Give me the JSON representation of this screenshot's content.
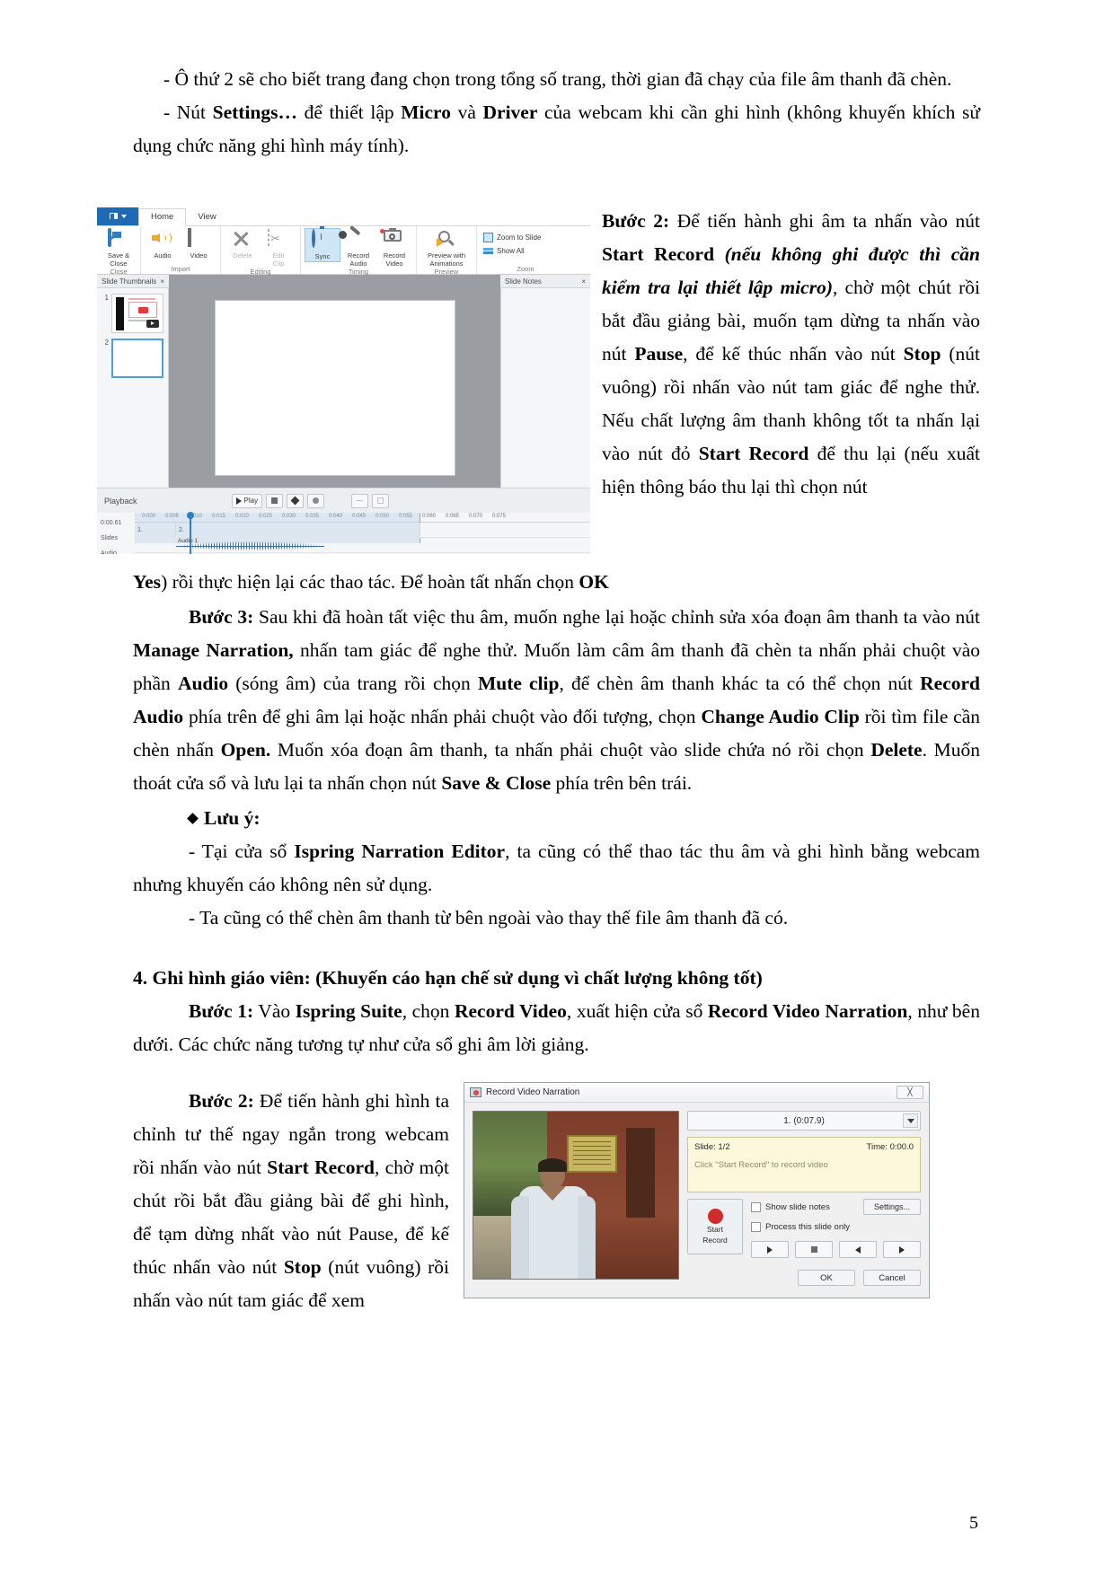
{
  "document": {
    "page_number": "5",
    "paragraphs": {
      "p1": "- Ô thứ 2 sẽ cho biết trang đang chọn trong tổng số trang, thời gian đã chạy của file âm thanh đã chèn.",
      "p2_a": "- Nút ",
      "p2_b": "Settings…",
      "p2_c": " để thiết lập ",
      "p2_d": "Micro",
      "p2_e": " và ",
      "p2_f": "Driver",
      "p2_g": " của webcam khi cần ghi hình (không khuyến khích sử dụng chức năng ghi hình máy tính).",
      "step2_label": "Bước 2:",
      "step2_t1": " Để tiến hành ghi âm ta nhấn vào nút ",
      "step2_b1": "Start Record",
      "step2_i1": " (nếu không ghi được thì cần kiểm tra lại thiết lập micro)",
      "step2_t2": ", chờ một chút rồi bắt đầu giảng bài, muốn tạm dừng ta nhấn vào nút ",
      "step2_b2": "Pause",
      "step2_t3": ", để kế thúc nhấn vào nút ",
      "step2_b3": "Stop",
      "step2_t4": " (nút vuông) rồi nhấn vào nút tam giác để nghe thử. Nếu chất lượng âm thanh không tốt ta nhấn lại vào nút đỏ ",
      "step2_b4": "Start Record",
      "step2_t5": " để thu lại (nếu xuất hiện thông báo thu lại thì chọn nút ",
      "step2_b5": "Yes",
      "step2_t6": ") rồi thực hiện lại các thao tác. Để hoàn tất nhấn chọn ",
      "step2_b6": "OK",
      "step3_label": "Bước 3:",
      "step3_t1": " Sau khi đã hoàn tất việc thu âm, muốn nghe lại hoặc chỉnh sửa xóa đoạn âm thanh ta vào nút ",
      "step3_b1": "Manage Narration,",
      "step3_t2": " nhấn tam giác để nghe thử. Muốn làm câm âm thanh đã chèn ta nhấn phải chuột vào phần ",
      "step3_b2": "Audio",
      "step3_t3": " (sóng âm) của trang rồi chọn ",
      "step3_b3": "Mute clip",
      "step3_t4": ", để chèn âm thanh khác ta có thể chọn nút ",
      "step3_b4": "Record  Audio",
      "step3_t5": " phía trên để ghi âm lại hoặc nhấn phải chuột vào đối tượng, chọn ",
      "step3_b5": "Change Audio Clip",
      "step3_t6": " rồi tìm file cần chèn nhấn ",
      "step3_b6": "Open.",
      "step3_t7": " Muốn xóa đoạn âm thanh, ta nhấn phải chuột vào slide chứa nó rồi chọn ",
      "step3_b7": "Delete",
      "step3_t8": ". Muốn thoát cửa sổ và lưu lại ta nhấn chọn nút ",
      "step3_b8": "Save & Close",
      "step3_t9": " phía trên bên trái.",
      "note_label": "Lưu ý:",
      "note1_a": "- Tại cửa sổ ",
      "note1_b": "Ispring Narration Editor",
      "note1_c": ", ta cũng có thể thao tác thu âm và ghi hình bằng webcam nhưng khuyến cáo không nên sử dụng.",
      "note2": "- Ta cũng có thể chèn âm thanh từ bên ngoài vào thay thế file âm thanh đã có.",
      "section4": "4. Ghi hình giáo viên: (Khuyến cáo hạn chế sử dụng vì chất lượng không tốt)",
      "s4step1_label": "Bước 1:",
      "s4step1_t1": " Vào ",
      "s4step1_b1": "Ispring Suite",
      "s4step1_t2": ", chọn  ",
      "s4step1_b2": "Record Video",
      "s4step1_t3": ", xuất hiện cửa sổ ",
      "s4step1_b3": "Record Video Narration",
      "s4step1_t4": ", như bên dưới. Các chức năng tương tự như cửa sổ ghi âm lời giảng.",
      "s4step2_label": "Bước 2:",
      "s4step2_t1": " Để tiến hành ghi hình ta chỉnh tư thế ngay ngắn trong webcam rồi nhấn vào nút ",
      "s4step2_b1": "Start Record",
      "s4step2_t2": ", chờ một chút rồi bắt đầu giảng bài để ghi hình, để tạm dừng nhất vào nút Pause, để kế thúc nhấn vào nút ",
      "s4step2_b2": "Stop",
      "s4step2_t3": " (nút vuông) rồi nhấn vào nút tam giác để xem"
    }
  },
  "narration_editor": {
    "file_menu": "file-menu",
    "tabs": [
      {
        "label": "Home",
        "active": true
      },
      {
        "label": "View",
        "active": false
      }
    ],
    "groups": [
      {
        "name": "Close",
        "items": [
          {
            "label": "Save &\nClose",
            "icon": "save-close-icon",
            "state": "normal"
          }
        ]
      },
      {
        "name": "Import",
        "items": [
          {
            "label": "Audio",
            "icon": "audio-icon",
            "state": "normal"
          },
          {
            "label": "Video",
            "icon": "video-icon",
            "state": "normal"
          }
        ]
      },
      {
        "name": "Editing",
        "items": [
          {
            "label": "Delete",
            "icon": "delete-icon",
            "state": "disabled"
          },
          {
            "label": "Edit\nClip",
            "icon": "edit-clip-icon",
            "state": "disabled"
          }
        ]
      },
      {
        "name": "Timing",
        "items": [
          {
            "label": "Sync",
            "icon": "sync-timer-icon",
            "state": "selected"
          },
          {
            "label": "Record\nAudio",
            "icon": "microphone-icon",
            "state": "normal"
          },
          {
            "label": "Record\nVideo",
            "icon": "webcam-icon",
            "state": "normal"
          }
        ]
      },
      {
        "name": "Preview",
        "items": [
          {
            "label": "Preview with\nAnimations",
            "icon": "preview-icon",
            "state": "normal"
          }
        ]
      },
      {
        "name": "Zoom",
        "items": [
          {
            "label": "Zoom to Slide",
            "icon": "zoom-to-slide-icon",
            "state": "small"
          },
          {
            "label": "Show All",
            "icon": "show-all-icon",
            "state": "small"
          }
        ]
      }
    ],
    "panels": {
      "thumbnails_title": "Slide Thumbnails",
      "thumbnails_close": "×",
      "notes_title": "Slide Notes",
      "notes_close": "×",
      "slides": [
        {
          "number": "1",
          "selected": false
        },
        {
          "number": "2",
          "selected": true
        }
      ]
    },
    "playback": {
      "label": "Playback",
      "play_button": "Play",
      "stop_button": "stop-icon",
      "prev_button": "prev-icon",
      "rec_button": "record-icon",
      "extra1": "zoom-out-icon",
      "extra2": "fit-icon"
    },
    "timeline": {
      "current_time": "0:00.61",
      "row_slides": "Slides",
      "row_audio": "Audio",
      "slide_cells": [
        "1.",
        "2."
      ],
      "audio_clip_label": "Audio 1",
      "ruler_ticks": [
        "0:000",
        "0:005",
        "0:010",
        "0:015",
        "0:020",
        "0:025",
        "0:030",
        "0:035",
        "0:040",
        "0:045",
        "0:050",
        "0:055",
        "0:060",
        "0:065",
        "0:070",
        "0:075"
      ]
    }
  },
  "record_video_dialog": {
    "title": "Record Video Narration",
    "title_icon": "record-video-icon",
    "close_button": "╳",
    "camera_preview": "webcam-preview",
    "slide_selector": "1. (0:07.9)",
    "status": {
      "slide_label": "Slide: 1/2",
      "time_label": "Time: 0:00.0",
      "hint": "Click \"Start Record\" to record video"
    },
    "start_record_button": "Start\nRecord",
    "start_record_line1": "Start",
    "start_record_line2": "Record",
    "checkbox_show_notes": "Show slide notes",
    "checkbox_process_slide": "Process this slide only",
    "settings_button": "Settings...",
    "transport": {
      "play": "play-icon",
      "stop": "stop-icon",
      "prev": "prev-icon",
      "next": "next-icon"
    },
    "ok_button": "OK",
    "cancel_button": "Cancel"
  },
  "colors": {
    "accent_blue": "#1e6ab4",
    "record_red": "#d22b2b",
    "status_bg": "#fbf8dc",
    "selected_tool": "#cfe6f7"
  }
}
